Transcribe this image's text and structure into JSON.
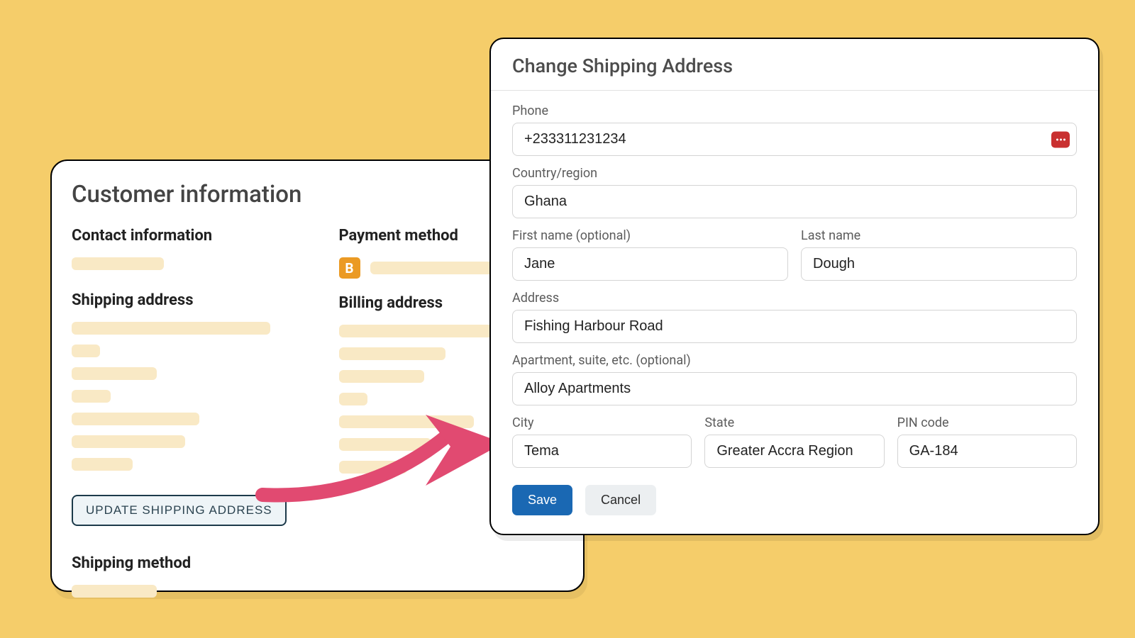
{
  "back": {
    "title": "Customer information",
    "contact_h": "Contact information",
    "payment_h": "Payment method",
    "pay_icon": "B",
    "ship_h": "Shipping address",
    "bill_h": "Billing address",
    "update_btn": "UPDATE SHIPPING ADDRESS",
    "method_h": "Shipping method"
  },
  "modal": {
    "title": "Change Shipping Address",
    "phone_label": "Phone",
    "phone_value": "+233311231234",
    "country_label": "Country/region",
    "country_value": "Ghana",
    "first_label": "First name (optional)",
    "first_value": "Jane",
    "last_label": "Last name",
    "last_value": "Dough",
    "address_label": "Address",
    "address_value": "Fishing Harbour Road",
    "apt_label": "Apartment, suite, etc. (optional)",
    "apt_value": "Alloy Apartments",
    "city_label": "City",
    "city_value": "Tema",
    "state_label": "State",
    "state_value": "Greater Accra Region",
    "pin_label": "PIN code",
    "pin_value": "GA-184",
    "save": "Save",
    "cancel": "Cancel"
  }
}
